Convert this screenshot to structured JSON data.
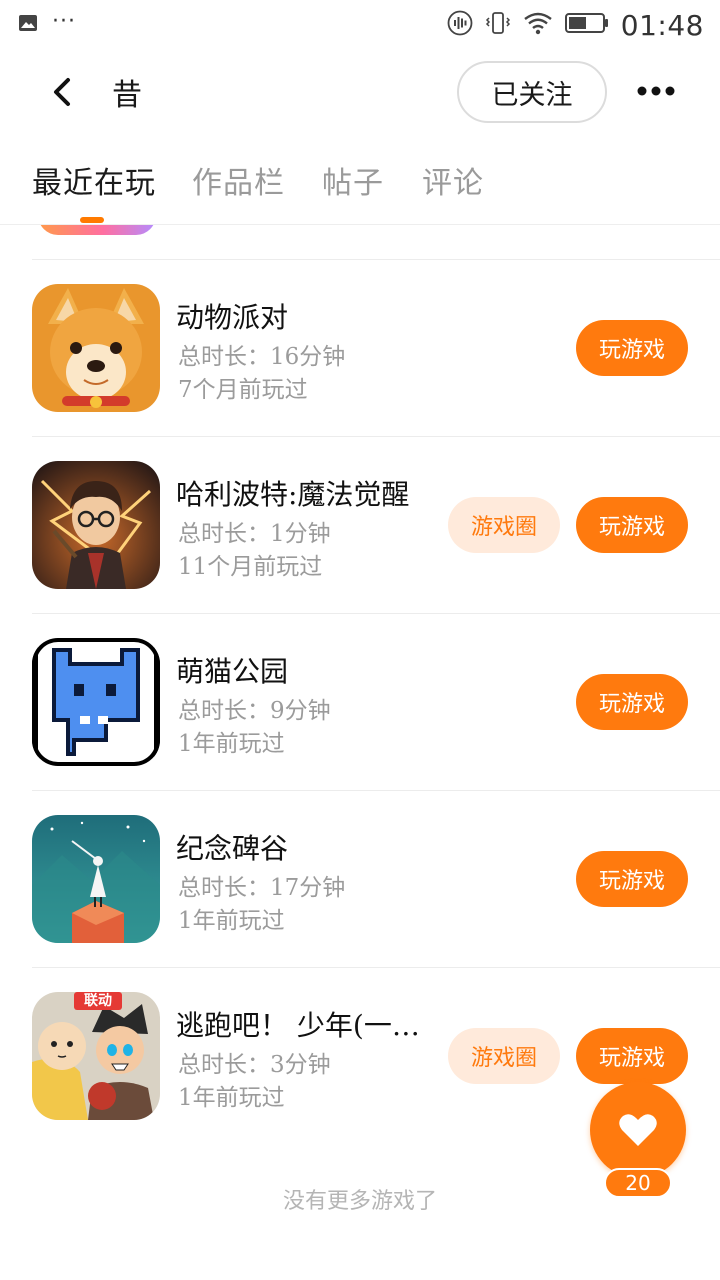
{
  "status_bar": {
    "time": "01:48",
    "notification_dots": "···",
    "icons": [
      "image-icon",
      "vibrate-icon",
      "sound-wave-icon",
      "wifi-icon",
      "battery-icon"
    ]
  },
  "header": {
    "title": "昔",
    "follow_label": "已关注"
  },
  "tabs": [
    {
      "label": "最近在玩"
    },
    {
      "label": "作品栏"
    },
    {
      "label": "帖子"
    },
    {
      "label": "评论"
    }
  ],
  "games": [
    {
      "name": "动物派对",
      "duration": "总时长：16分钟",
      "last_played": "7个月前玩过",
      "has_circle": false
    },
    {
      "name": "哈利波特:魔法觉醒",
      "duration": "总时长：1分钟",
      "last_played": "11个月前玩过",
      "has_circle": true
    },
    {
      "name": "萌猫公园",
      "duration": "总时长：9分钟",
      "last_played": "1年前玩过",
      "has_circle": false
    },
    {
      "name": "纪念碑谷",
      "duration": "总时长：17分钟",
      "last_played": "1年前玩过",
      "has_circle": false
    },
    {
      "name": "逃跑吧！ 少年(一…",
      "duration": "总时长：3分钟",
      "last_played": "1年前玩过",
      "has_circle": true,
      "icon_badge": "联动"
    }
  ],
  "buttons": {
    "play": "玩游戏",
    "circle": "游戏圈"
  },
  "footer": {
    "no_more": "没有更多游戏了"
  },
  "like": {
    "count": "20"
  },
  "colors": {
    "accent": "#ff7a0e",
    "accent_light": "#ffeadb",
    "muted_text": "#9b9b9b"
  }
}
